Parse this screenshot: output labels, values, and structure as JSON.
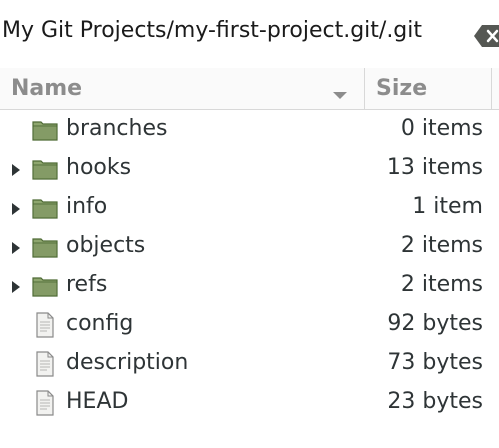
{
  "pathbar": {
    "path": "My Git Projects/my-first-project.git/.git"
  },
  "columns": {
    "name": "Name",
    "size": "Size"
  },
  "items": [
    {
      "name": "branches",
      "size": "0 items",
      "type": "folder",
      "expandable": false
    },
    {
      "name": "hooks",
      "size": "13 items",
      "type": "folder",
      "expandable": true
    },
    {
      "name": "info",
      "size": "1 item",
      "type": "folder",
      "expandable": true
    },
    {
      "name": "objects",
      "size": "2 items",
      "type": "folder",
      "expandable": true
    },
    {
      "name": "refs",
      "size": "2 items",
      "type": "folder",
      "expandable": true
    },
    {
      "name": "config",
      "size": "92 bytes",
      "type": "file",
      "expandable": false
    },
    {
      "name": "description",
      "size": "73 bytes",
      "type": "file",
      "expandable": false
    },
    {
      "name": "HEAD",
      "size": "23 bytes",
      "type": "file",
      "expandable": false
    }
  ],
  "colors": {
    "folder_fill": "#8ea66e",
    "folder_stroke": "#4e6a35",
    "file_fill": "#f2f2f0",
    "file_stroke": "#8a8a8a",
    "header_text": "#8c8c8c",
    "text": "#2e3436"
  }
}
